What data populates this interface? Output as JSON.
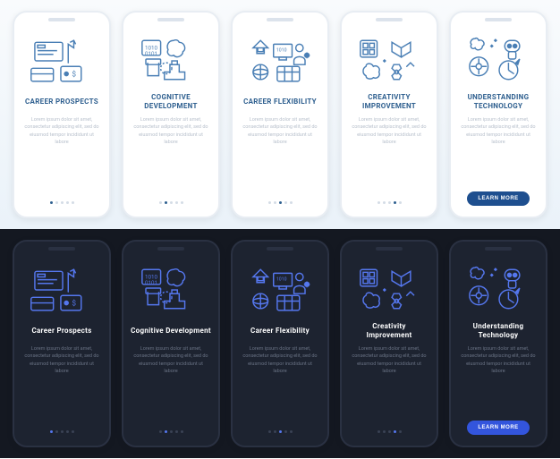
{
  "body_text": "Lorem ipsum dolor sit amet, consectetur adipiscing elit, sed do eiusmod tempor incididunt ut labore",
  "cta_label": "LEARN MORE",
  "slides": [
    {
      "title_light": "CAREER PROSPECTS",
      "title_dark": "Career Prospects",
      "icon": "career-prospects"
    },
    {
      "title_light": "COGNITIVE DEVELOPMENT",
      "title_dark": "Cognitive Development",
      "icon": "cognitive-development"
    },
    {
      "title_light": "CAREER FLEXIBILITY",
      "title_dark": "Career Flexibility",
      "icon": "career-flexibility"
    },
    {
      "title_light": "CREATIVITY IMPROVEMENT",
      "title_dark": "Creativity Improvement",
      "icon": "creativity-improvement"
    },
    {
      "title_light": "UNDERSTANDING TECHNOLOGY",
      "title_dark": "Understanding Technology",
      "icon": "understanding-technology"
    }
  ],
  "colors": {
    "light_stroke": "#4a7fb5",
    "dark_stroke": "#5577ee",
    "cta_light": "#1e4f8f",
    "cta_dark": "#3355dd"
  }
}
